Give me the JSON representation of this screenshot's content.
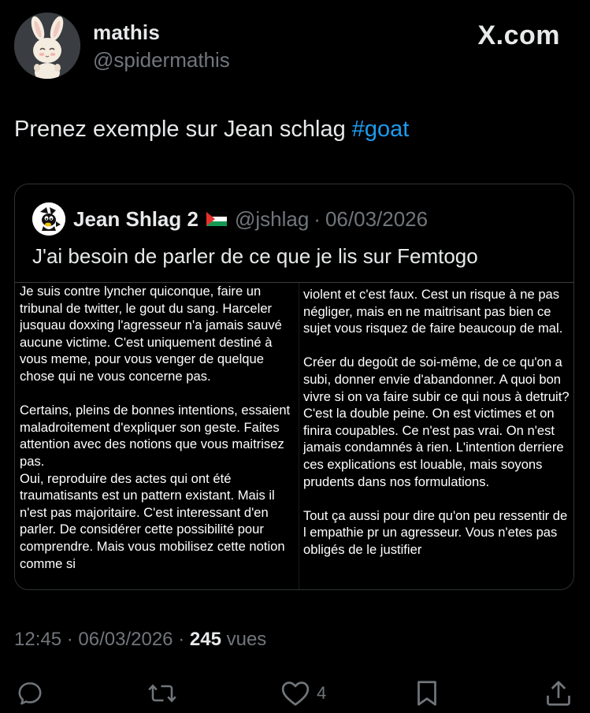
{
  "author": {
    "display_name": "mathis",
    "handle": "@spidermathis",
    "avatar_icon": "bunny-avatar-icon"
  },
  "brand": {
    "text": "X.com"
  },
  "tweet": {
    "text": "Prenez exemple sur Jean schlag ",
    "hashtag": "#goat"
  },
  "quote": {
    "display_name": "Jean Shlag 2",
    "flag_icon": "palestine-flag-icon",
    "handle": "@jshlag",
    "separator": "·",
    "date": "06/03/2026",
    "text": "J'ai besoin de parler de ce que je lis sur Femtogo",
    "image": {
      "left_column": [
        "Je suis contre lyncher quiconque, faire un tribunal de twitter, le gout du sang. Harceler jusquau doxxing l'agresseur n'a jamais sauvé aucune victime. C'est uniquement destiné à vous meme, pour vous venger de quelque chose qui ne vous concerne pas.",
        "Certains, pleins de bonnes intentions, essaient maladroitement d'expliquer son geste. Faites attention avec des notions que vous maitrisez pas.",
        "Oui, reproduire des actes qui ont été traumatisants est un pattern existant. Mais il n'est pas majoritaire. C'est interessant d'en parler. De considérer cette possibilité pour comprendre. Mais vous mobilisez cette notion comme si"
      ],
      "right_column": [
        "violent et c'est faux. Cest un risque à ne pas négliger, mais en ne maitrisant pas bien ce sujet vous risquez de faire beaucoup de mal.",
        "Créer du degoût de soi-même, de ce qu'on a subi, donner envie d'abandonner. A quoi bon vivre si on va faire subir ce qui nous à detruit? C'est la double peine. On est victimes et on finira coupables. Ce n'est pas vrai. On n'est jamais condamnés à rien. L'intention derriere ces explications est louable, mais soyons prudents dans nos formulations.",
        "Tout ça aussi pour dire qu'on peu ressentir de l empathie pr un agresseur. Vous n'etes pas obligés de le justifier"
      ]
    }
  },
  "meta": {
    "time": "12:45",
    "separator": "·",
    "date": "06/03/2026",
    "views_count": "245",
    "views_label": "vues"
  },
  "actions": {
    "reply_icon": "reply-icon",
    "retweet_icon": "retweet-icon",
    "like_icon": "heart-icon",
    "like_count": "4",
    "bookmark_icon": "bookmark-icon",
    "share_icon": "share-icon"
  },
  "colors": {
    "background": "#000000",
    "text": "#e7e9ea",
    "secondary": "#71767b",
    "link": "#1d9bf0",
    "border": "#2f3336"
  }
}
